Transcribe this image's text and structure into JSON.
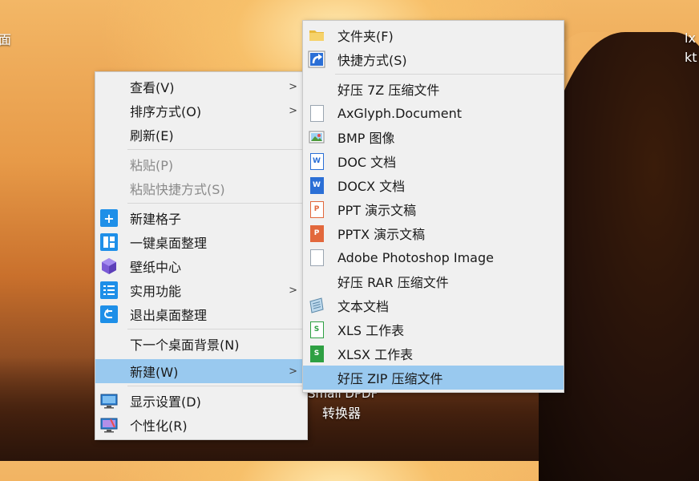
{
  "desktop": {
    "top_left": "面",
    "top_right_1": "lx",
    "top_right_2": "kt",
    "icon_label_1": "Small DPDF",
    "icon_label_2": "转换器"
  },
  "main_menu": {
    "view": "查看(V)",
    "sort": "排序方式(O)",
    "refresh": "刷新(E)",
    "paste": "粘贴(P)",
    "paste_shortcut": "粘贴快捷方式(S)",
    "new_grid": "新建格子",
    "one_click_organize": "一键桌面整理",
    "wallpaper_center": "壁纸中心",
    "utilities": "实用功能",
    "exit_organize": "退出桌面整理",
    "next_background": "下一个桌面背景(N)",
    "new": "新建(W)",
    "display_settings": "显示设置(D)",
    "personalize": "个性化(R)"
  },
  "sub_menu": {
    "folder": "文件夹(F)",
    "shortcut": "快捷方式(S)",
    "archive_7z": "好压 7Z 压缩文件",
    "axglyph": "AxGlyph.Document",
    "bmp": "BMP 图像",
    "doc": "DOC 文档",
    "docx": "DOCX 文档",
    "ppt": "PPT 演示文稿",
    "pptx": "PPTX 演示文稿",
    "photoshop": "Adobe Photoshop Image",
    "archive_rar": "好压 RAR 压缩文件",
    "text": "文本文档",
    "xls": "XLS 工作表",
    "xlsx": "XLSX 工作表",
    "archive_zip": "好压 ZIP 压缩文件"
  },
  "colors": {
    "menu_bg": "#f0f0f0",
    "highlight": "#99c9ef",
    "tile_blue": "#1e8fe8"
  }
}
